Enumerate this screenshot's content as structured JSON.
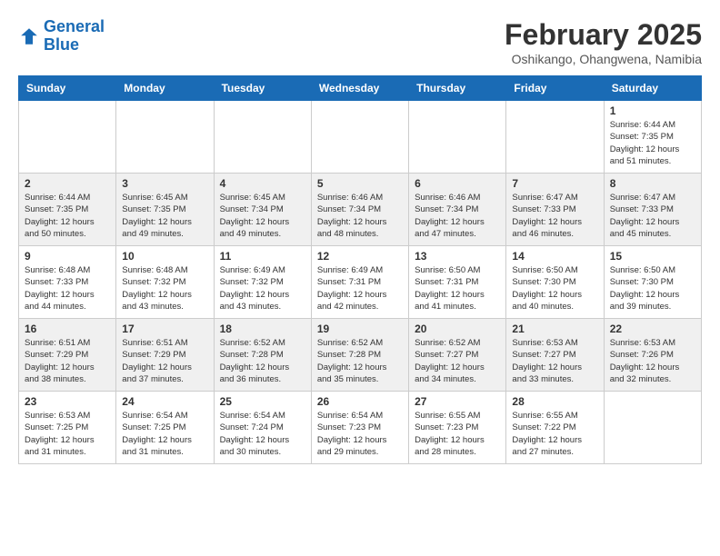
{
  "header": {
    "logo_line1": "General",
    "logo_line2": "Blue",
    "month_title": "February 2025",
    "subtitle": "Oshikango, Ohangwena, Namibia"
  },
  "weekdays": [
    "Sunday",
    "Monday",
    "Tuesday",
    "Wednesday",
    "Thursday",
    "Friday",
    "Saturday"
  ],
  "weeks": [
    [
      {
        "day": "",
        "info": ""
      },
      {
        "day": "",
        "info": ""
      },
      {
        "day": "",
        "info": ""
      },
      {
        "day": "",
        "info": ""
      },
      {
        "day": "",
        "info": ""
      },
      {
        "day": "",
        "info": ""
      },
      {
        "day": "1",
        "info": "Sunrise: 6:44 AM\nSunset: 7:35 PM\nDaylight: 12 hours\nand 51 minutes."
      }
    ],
    [
      {
        "day": "2",
        "info": "Sunrise: 6:44 AM\nSunset: 7:35 PM\nDaylight: 12 hours\nand 50 minutes."
      },
      {
        "day": "3",
        "info": "Sunrise: 6:45 AM\nSunset: 7:35 PM\nDaylight: 12 hours\nand 49 minutes."
      },
      {
        "day": "4",
        "info": "Sunrise: 6:45 AM\nSunset: 7:34 PM\nDaylight: 12 hours\nand 49 minutes."
      },
      {
        "day": "5",
        "info": "Sunrise: 6:46 AM\nSunset: 7:34 PM\nDaylight: 12 hours\nand 48 minutes."
      },
      {
        "day": "6",
        "info": "Sunrise: 6:46 AM\nSunset: 7:34 PM\nDaylight: 12 hours\nand 47 minutes."
      },
      {
        "day": "7",
        "info": "Sunrise: 6:47 AM\nSunset: 7:33 PM\nDaylight: 12 hours\nand 46 minutes."
      },
      {
        "day": "8",
        "info": "Sunrise: 6:47 AM\nSunset: 7:33 PM\nDaylight: 12 hours\nand 45 minutes."
      }
    ],
    [
      {
        "day": "9",
        "info": "Sunrise: 6:48 AM\nSunset: 7:33 PM\nDaylight: 12 hours\nand 44 minutes."
      },
      {
        "day": "10",
        "info": "Sunrise: 6:48 AM\nSunset: 7:32 PM\nDaylight: 12 hours\nand 43 minutes."
      },
      {
        "day": "11",
        "info": "Sunrise: 6:49 AM\nSunset: 7:32 PM\nDaylight: 12 hours\nand 43 minutes."
      },
      {
        "day": "12",
        "info": "Sunrise: 6:49 AM\nSunset: 7:31 PM\nDaylight: 12 hours\nand 42 minutes."
      },
      {
        "day": "13",
        "info": "Sunrise: 6:50 AM\nSunset: 7:31 PM\nDaylight: 12 hours\nand 41 minutes."
      },
      {
        "day": "14",
        "info": "Sunrise: 6:50 AM\nSunset: 7:30 PM\nDaylight: 12 hours\nand 40 minutes."
      },
      {
        "day": "15",
        "info": "Sunrise: 6:50 AM\nSunset: 7:30 PM\nDaylight: 12 hours\nand 39 minutes."
      }
    ],
    [
      {
        "day": "16",
        "info": "Sunrise: 6:51 AM\nSunset: 7:29 PM\nDaylight: 12 hours\nand 38 minutes."
      },
      {
        "day": "17",
        "info": "Sunrise: 6:51 AM\nSunset: 7:29 PM\nDaylight: 12 hours\nand 37 minutes."
      },
      {
        "day": "18",
        "info": "Sunrise: 6:52 AM\nSunset: 7:28 PM\nDaylight: 12 hours\nand 36 minutes."
      },
      {
        "day": "19",
        "info": "Sunrise: 6:52 AM\nSunset: 7:28 PM\nDaylight: 12 hours\nand 35 minutes."
      },
      {
        "day": "20",
        "info": "Sunrise: 6:52 AM\nSunset: 7:27 PM\nDaylight: 12 hours\nand 34 minutes."
      },
      {
        "day": "21",
        "info": "Sunrise: 6:53 AM\nSunset: 7:27 PM\nDaylight: 12 hours\nand 33 minutes."
      },
      {
        "day": "22",
        "info": "Sunrise: 6:53 AM\nSunset: 7:26 PM\nDaylight: 12 hours\nand 32 minutes."
      }
    ],
    [
      {
        "day": "23",
        "info": "Sunrise: 6:53 AM\nSunset: 7:25 PM\nDaylight: 12 hours\nand 31 minutes."
      },
      {
        "day": "24",
        "info": "Sunrise: 6:54 AM\nSunset: 7:25 PM\nDaylight: 12 hours\nand 31 minutes."
      },
      {
        "day": "25",
        "info": "Sunrise: 6:54 AM\nSunset: 7:24 PM\nDaylight: 12 hours\nand 30 minutes."
      },
      {
        "day": "26",
        "info": "Sunrise: 6:54 AM\nSunset: 7:23 PM\nDaylight: 12 hours\nand 29 minutes."
      },
      {
        "day": "27",
        "info": "Sunrise: 6:55 AM\nSunset: 7:23 PM\nDaylight: 12 hours\nand 28 minutes."
      },
      {
        "day": "28",
        "info": "Sunrise: 6:55 AM\nSunset: 7:22 PM\nDaylight: 12 hours\nand 27 minutes."
      },
      {
        "day": "",
        "info": ""
      }
    ]
  ]
}
